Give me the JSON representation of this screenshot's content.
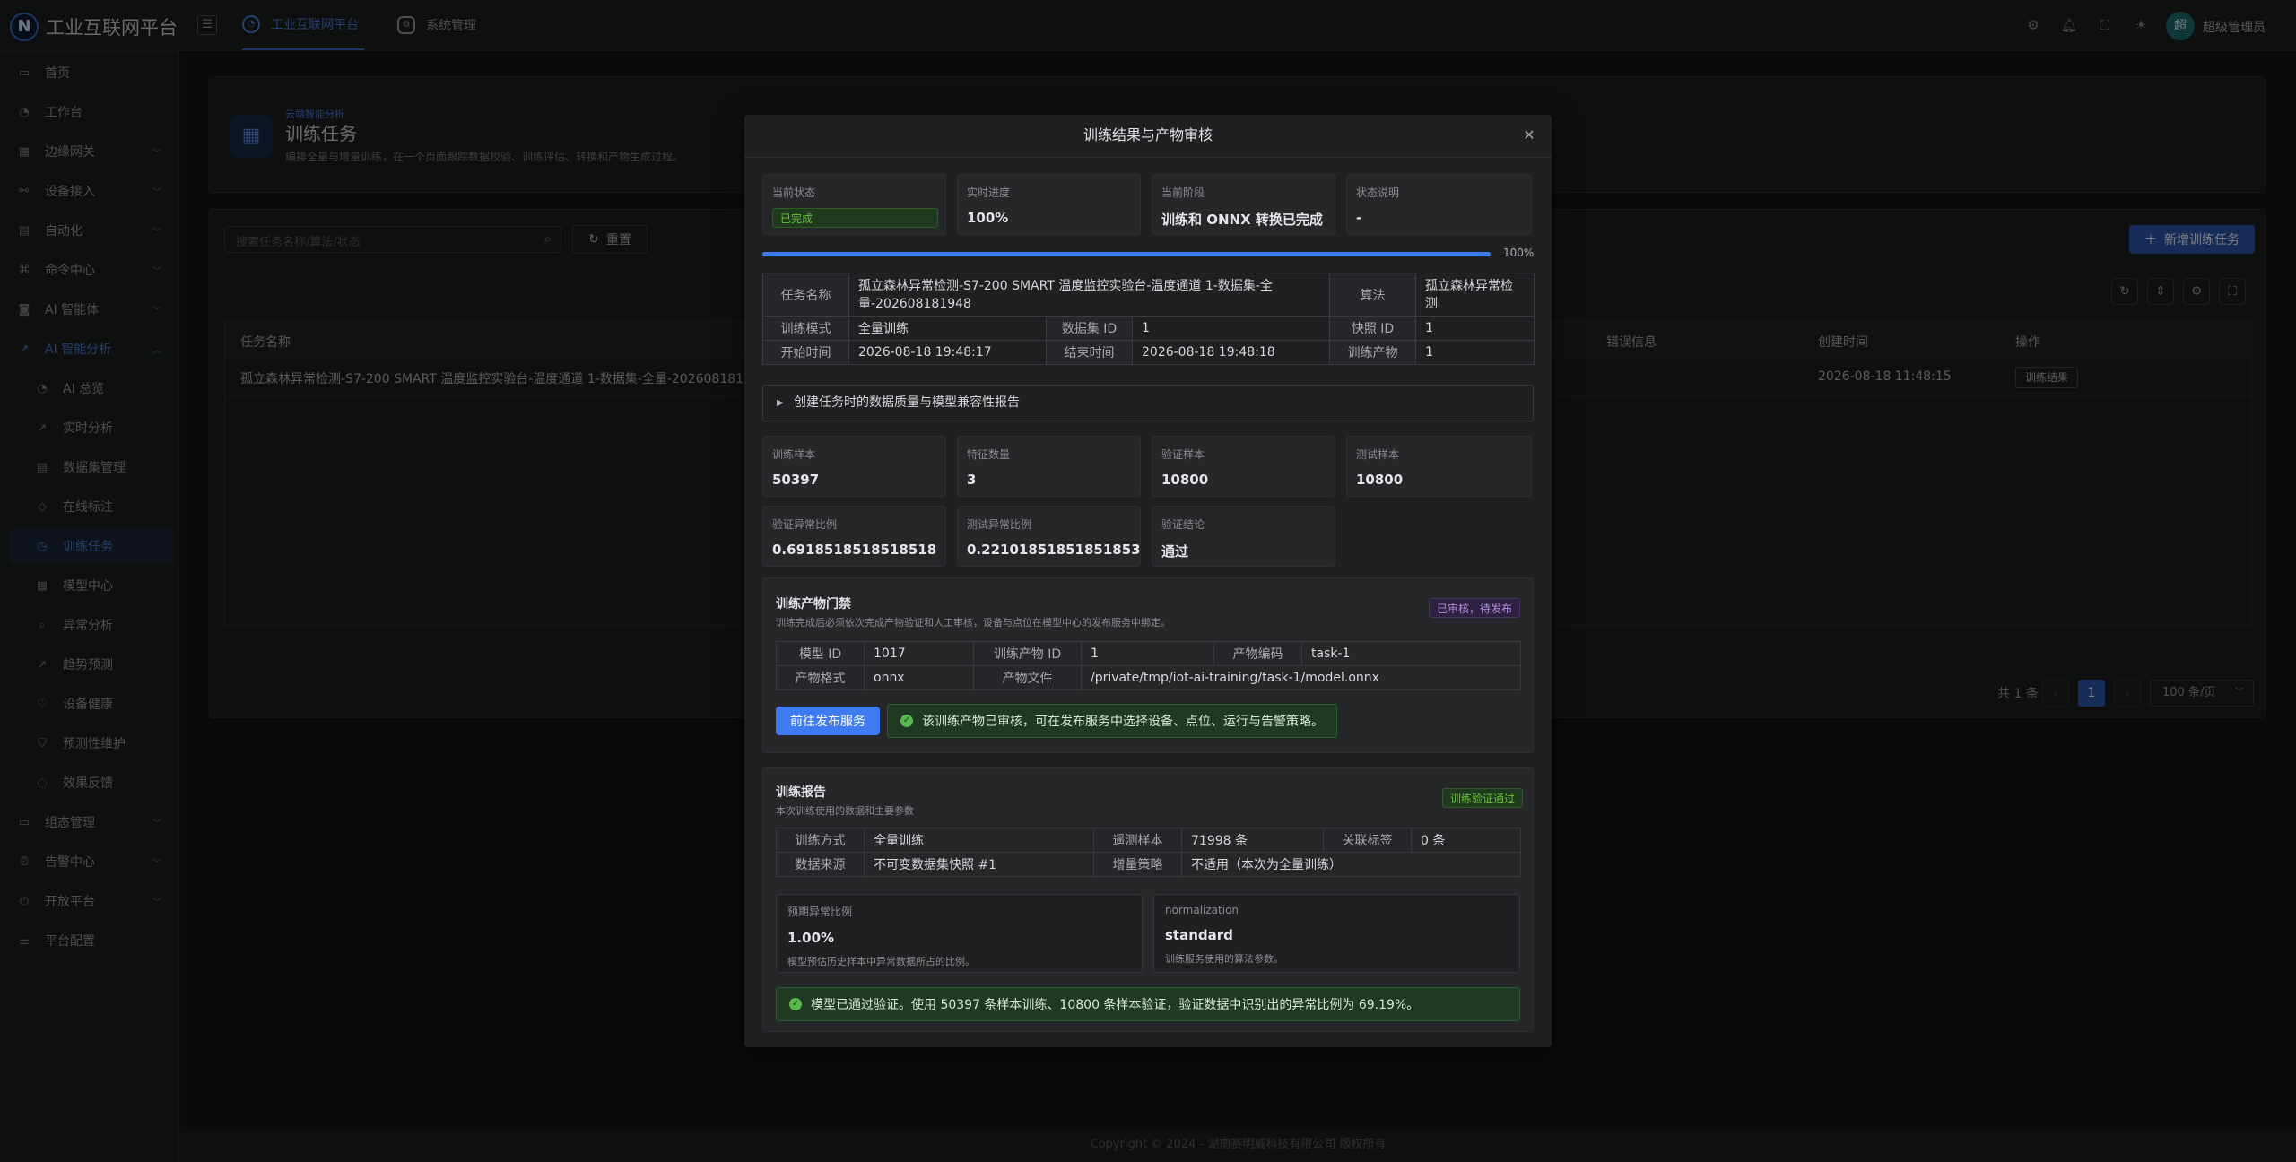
{
  "header": {
    "logo_letter": "N",
    "app_title": "工业互联网平台",
    "tabs": [
      {
        "label": "工业互联网平台"
      },
      {
        "label": "系统管理"
      }
    ],
    "avatar_text": "超",
    "user_name": "超级管理员"
  },
  "sidebar": {
    "items": [
      {
        "label": "首页"
      },
      {
        "label": "工作台"
      },
      {
        "label": "边缘网关"
      },
      {
        "label": "设备接入"
      },
      {
        "label": "自动化"
      },
      {
        "label": "命令中心"
      },
      {
        "label": "AI 智能体"
      },
      {
        "label": "AI 智能分析"
      },
      {
        "label": "AI 总览"
      },
      {
        "label": "实时分析"
      },
      {
        "label": "数据集管理"
      },
      {
        "label": "在线标注"
      },
      {
        "label": "训练任务"
      },
      {
        "label": "模型中心"
      },
      {
        "label": "异常分析"
      },
      {
        "label": "趋势预测"
      },
      {
        "label": "设备健康"
      },
      {
        "label": "预测性维护"
      },
      {
        "label": "效果反馈"
      },
      {
        "label": "组态管理"
      },
      {
        "label": "告警中心"
      },
      {
        "label": "开放平台"
      },
      {
        "label": "平台配置"
      }
    ]
  },
  "page": {
    "breadcrumb": "云端智能分析",
    "title": "训练任务",
    "desc": "编排全量与增量训练，在一个页面跟踪数据校验、训练评估、转换和产物生成过程。",
    "search_placeholder": "搜索任务名称/算法/状态",
    "reset_label": "重置",
    "add_label": "新增训练任务",
    "table_headers": [
      "任务名称",
      "错误信息",
      "创建时间",
      "操作"
    ],
    "row": {
      "name": "孤立森林异常检测-S7-200 SMART 温度监控实验台-温度通道 1-数据集-全量-20260818194",
      "created": "2026-08-18 11:48:15",
      "action": "训练结果"
    },
    "pagination": {
      "total": "共 1 条",
      "current": "1",
      "page_size": "100 条/页"
    }
  },
  "dialog": {
    "title": "训练结果与产物审核",
    "stats": [
      {
        "label": "当前状态",
        "value": "已完成"
      },
      {
        "label": "实时进度",
        "value": "100%"
      },
      {
        "label": "当前阶段",
        "value": "训练和 ONNX 转换已完成"
      },
      {
        "label": "状态说明",
        "value": "-"
      }
    ],
    "progress": 1.0,
    "progress_text": "100%",
    "info": {
      "task_name_k": "任务名称",
      "task_name_v": "孤立森林异常检测-S7-200 SMART 温度监控实验台-温度通道 1-数据集-全量-202608181948",
      "algo_k": "算法",
      "algo_v": "孤立森林异常检测",
      "mode_k": "训练模式",
      "mode_v": "全量训练",
      "dataset_k": "数据集 ID",
      "dataset_v": "1",
      "snapshot_k": "快照 ID",
      "snapshot_v": "1",
      "start_k": "开始时间",
      "start_v": "2026-08-18 19:48:17",
      "end_k": "结束时间",
      "end_v": "2026-08-18 19:48:18",
      "artifact_k": "训练产物",
      "artifact_v": "1"
    },
    "collapse_label": "创建任务时的数据质量与模型兼容性报告",
    "metrics_row1": [
      {
        "label": "训练样本",
        "value": "50397"
      },
      {
        "label": "特征数量",
        "value": "3"
      },
      {
        "label": "验证样本",
        "value": "10800"
      },
      {
        "label": "测试样本",
        "value": "10800"
      }
    ],
    "metrics_row2": [
      {
        "label": "验证异常比例",
        "value": "0.6918518518518518"
      },
      {
        "label": "测试异常比例",
        "value": "0.22101851851851853"
      },
      {
        "label": "验证结论",
        "value": "通过"
      }
    ],
    "gate": {
      "title": "训练产物门禁",
      "desc": "训练完成后必须依次完成产物验证和人工审核，设备与点位在模型中心的发布服务中绑定。",
      "badge": "已审核，待发布",
      "model_id_k": "模型 ID",
      "model_id_v": "1017",
      "artifact_id_k": "训练产物 ID",
      "artifact_id_v": "1",
      "code_k": "产物编码",
      "code_v": "task-1",
      "format_k": "产物格式",
      "format_v": "onnx",
      "file_k": "产物文件",
      "file_v": "/private/tmp/iot-ai-training/task-1/model.onnx",
      "publish_button": "前往发布服务",
      "notice": "该训练产物已审核，可在发布服务中选择设备、点位、运行与告警策略。"
    },
    "report": {
      "title": "训练报告",
      "desc": "本次训练使用的数据和主要参数",
      "badge": "训练验证通过",
      "method_k": "训练方式",
      "method_v": "全量训练",
      "remote_k": "遥测样本",
      "remote_v": "71998 条",
      "label_k": "关联标签",
      "label_v": "0 条",
      "source_k": "数据来源",
      "source_v": "不可变数据集快照 #1",
      "incr_k": "增量策略",
      "incr_v": "不适用（本次为全量训练）",
      "cards": [
        {
          "label": "预期异常比例",
          "value": "1.00%",
          "desc": "模型预估历史样本中异常数据所占的比例。"
        },
        {
          "label": "normalization",
          "value": "standard",
          "desc": "训练服务使用的算法参数。"
        }
      ],
      "summary": "模型已通过验证。使用 50397 条样本训练、10800 条样本验证，验证数据中识别出的异常比例为 69.19%。"
    }
  },
  "footer": "Copyright © 2024 - 湖南赛明威科技有限公司 版权所有",
  "colors": {
    "accent": "#3e7bf0",
    "success": "#67c23a",
    "purple": "#b48be0"
  }
}
